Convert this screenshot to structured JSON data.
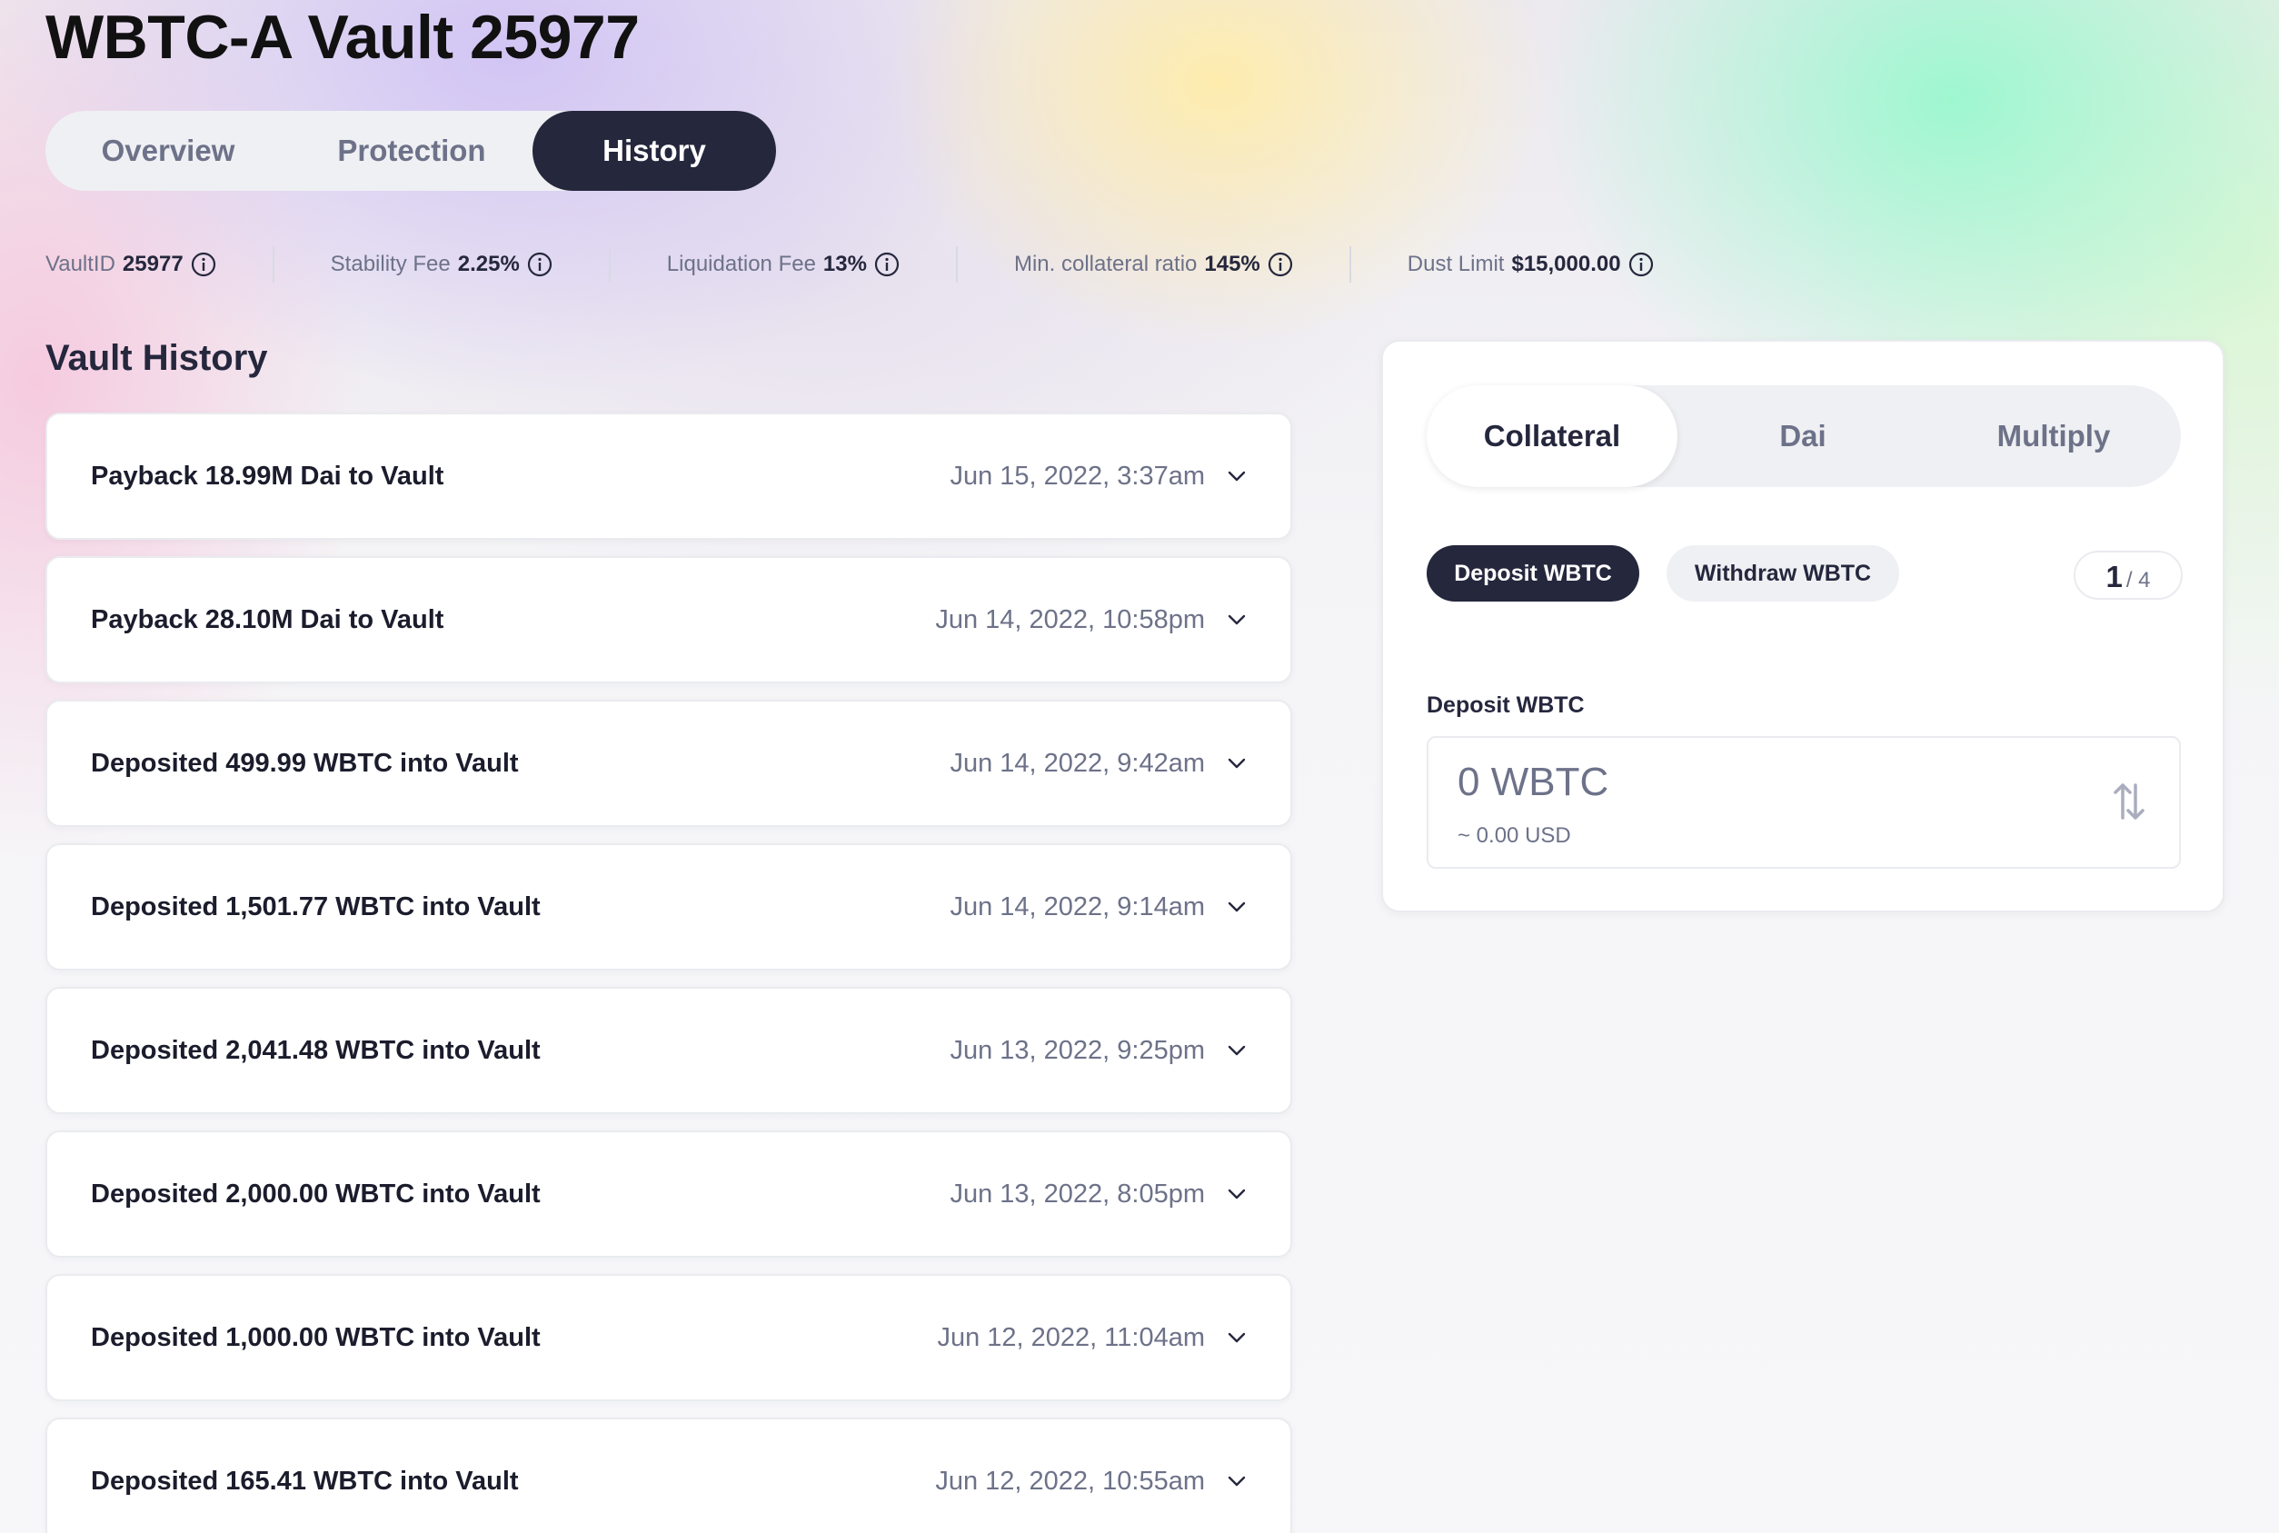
{
  "vault": {
    "title": "WBTC-A Vault 25977"
  },
  "tabs": [
    "Overview",
    "Protection",
    "History"
  ],
  "stats": [
    {
      "label": "VaultID",
      "value": "25977"
    },
    {
      "label": "Stability Fee",
      "value": "2.25%"
    },
    {
      "label": "Liquidation Fee",
      "value": "13%"
    },
    {
      "label": "Min. collateral ratio",
      "value": "145%"
    },
    {
      "label": "Dust Limit",
      "value": "$15,000.00"
    }
  ],
  "history": {
    "title": "Vault History",
    "items": [
      {
        "action": "Payback 18.99M Dai to Vault",
        "date": "Jun 15, 2022, 3:37am"
      },
      {
        "action": "Payback 28.10M Dai to Vault",
        "date": "Jun 14, 2022, 10:58pm"
      },
      {
        "action": "Deposited 499.99 WBTC into Vault",
        "date": "Jun 14, 2022, 9:42am"
      },
      {
        "action": "Deposited 1,501.77 WBTC into Vault",
        "date": "Jun 14, 2022, 9:14am"
      },
      {
        "action": "Deposited 2,041.48 WBTC into Vault",
        "date": "Jun 13, 2022, 9:25pm"
      },
      {
        "action": "Deposited 2,000.00 WBTC into Vault",
        "date": "Jun 13, 2022, 8:05pm"
      },
      {
        "action": "Deposited 1,000.00 WBTC into Vault",
        "date": "Jun 12, 2022, 11:04am"
      },
      {
        "action": "Deposited 165.41 WBTC into Vault",
        "date": "Jun 12, 2022, 10:55am"
      }
    ]
  },
  "panel": {
    "tabs": [
      "Collateral",
      "Dai",
      "Multiply"
    ],
    "actions": {
      "deposit": "Deposit WBTC",
      "withdraw": "Withdraw WBTC"
    },
    "step": {
      "current": "1",
      "total": "/ 4"
    },
    "deposit": {
      "label": "Deposit WBTC",
      "placeholder": "0 WBTC",
      "usd": "~ 0.00 USD"
    }
  },
  "icons": {
    "info": "info-icon",
    "chevron": "chevron-down-icon",
    "swap": "swap-arrows-icon"
  },
  "colors": {
    "dark": "#25273d",
    "muted": "#6d7289",
    "border": "#eaebef"
  }
}
